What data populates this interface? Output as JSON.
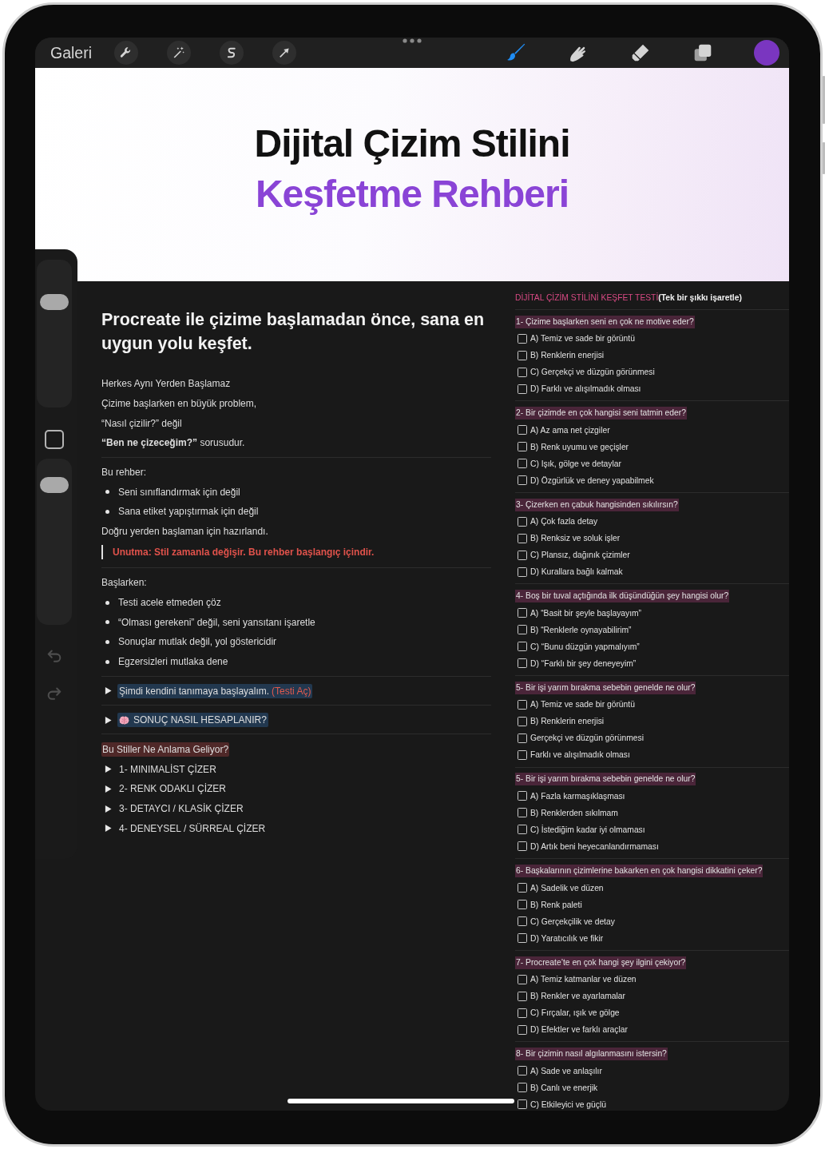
{
  "toolbar": {
    "gallery_label": "Galeri",
    "paint_tools": [
      {
        "selected": true
      },
      {
        "selected": false
      },
      {
        "selected": false
      },
      {
        "selected": false
      }
    ],
    "color_swatch": {
      "color": "#7a36c0"
    }
  },
  "side_panel": {
    "brush_size": {
      "level": 0.74
    },
    "opacity": {
      "level": 0.88
    }
  },
  "banner": {
    "title_line_1": "Dijital Çizim Stilini",
    "title_line_2": "Keşfetme Rehberi"
  },
  "guide": {
    "heading": "Procreate ile çizime başlamadan önce, sana en uygun yolu keşfet.",
    "blocks": [
      {
        "kind": "text",
        "text": "Herkes Aynı Yerden Başlamaz"
      },
      {
        "kind": "text",
        "text": "Çizime başlarken en büyük problem,"
      },
      {
        "kind": "text",
        "text": "“Nasıl çizilir?” değil"
      },
      {
        "kind": "text",
        "text": "**“Ben ne çizeceğim?”** sorusudur."
      },
      {
        "kind": "divider"
      },
      {
        "kind": "text",
        "text": "Bu rehber:"
      },
      {
        "kind": "bullet",
        "text": "Seni sınıflandırmak için değil"
      },
      {
        "kind": "bullet",
        "text": "Sana etiket yapıştırmak için değil"
      },
      {
        "kind": "text",
        "text": "Doğru yerden başlaman için hazırlandı."
      },
      {
        "kind": "quote",
        "text": "Unutma: Stil zamanla değişir. Bu rehber başlangıç içindir."
      },
      {
        "kind": "divider"
      },
      {
        "kind": "text",
        "text": "Başlarken:"
      },
      {
        "kind": "bullet",
        "text": "Testi acele etmeden çöz"
      },
      {
        "kind": "bullet",
        "text": "“Olması gerekeni” değil, seni yansıtanı işaretle"
      },
      {
        "kind": "bullet",
        "text": "Sonuçlar mutlak değil, yol göstericidir"
      },
      {
        "kind": "bullet",
        "text": "Egzersizleri mutlaka dene"
      },
      {
        "kind": "divider"
      },
      {
        "kind": "toggle",
        "text": "Şimdi kendini tanımaya başlayalım.",
        "link": "(Testi Aç)",
        "highlighted": true,
        "has_icon": false,
        "expanded": false
      },
      {
        "kind": "divider"
      },
      {
        "kind": "toggle",
        "text": "SONUÇ NASIL HESAPLANIR?",
        "highlighted": true,
        "has_icon": true,
        "expanded": false
      },
      {
        "kind": "divider"
      },
      {
        "kind": "tag_heading",
        "text": "Bu Stiller Ne Anlama Geliyor?"
      },
      {
        "kind": "toggle",
        "text": "1- MINIMALİST ÇİZER",
        "highlighted": false,
        "has_icon": false,
        "expanded": false
      },
      {
        "kind": "toggle",
        "text": "2- RENK ODAKLI ÇİZER",
        "highlighted": false,
        "has_icon": false,
        "expanded": false
      },
      {
        "kind": "toggle",
        "text": "3- DETAYCI / KLASİK ÇİZER",
        "highlighted": false,
        "has_icon": false,
        "expanded": false
      },
      {
        "kind": "toggle",
        "text": "4- DENEYSEL / SÜRREAL ÇİZER",
        "highlighted": false,
        "has_icon": false,
        "expanded": false
      }
    ]
  },
  "quiz": {
    "title": "DİJİTAL ÇİZİM STİLİNİ KEŞFET TESTİ",
    "hint": "(Tek bir şıkkı işaretle)",
    "questions": [
      {
        "title": "1- Çizime başlarken seni en çok ne motive eder?",
        "options": [
          {
            "text": "A) Temiz ve sade bir görüntü",
            "checked": false
          },
          {
            "text": "B) Renklerin enerjisi",
            "checked": false
          },
          {
            "text": "C) Gerçekçi ve düzgün görünmesi",
            "checked": false
          },
          {
            "text": "D) Farklı ve alışılmadık olması",
            "checked": false
          }
        ]
      },
      {
        "title": "2- Bir çizimde en çok hangisi seni tatmin eder?",
        "options": [
          {
            "text": "A) Az ama net çizgiler",
            "checked": false
          },
          {
            "text": "B) Renk uyumu ve geçişler",
            "checked": false
          },
          {
            "text": "C) Işık, gölge ve detaylar",
            "checked": false
          },
          {
            "text": "D) Özgürlük ve deney yapabilmek",
            "checked": false
          }
        ]
      },
      {
        "title": "3- Çizerken en çabuk hangisinden sıkılırsın?",
        "options": [
          {
            "text": "A) Çok fazla detay",
            "checked": false
          },
          {
            "text": "B) Renksiz ve soluk işler",
            "checked": false
          },
          {
            "text": "C) Plansız, dağınık çizimler",
            "checked": false
          },
          {
            "text": "D) Kurallara bağlı kalmak",
            "checked": false
          }
        ]
      },
      {
        "title": "4- Boş bir tuval açtığında ilk düşündüğün şey hangisi olur?",
        "options": [
          {
            "text": "A) “Basit bir şeyle başlayayım”",
            "checked": false
          },
          {
            "text": "B) “Renklerle oynayabilirim”",
            "checked": false
          },
          {
            "text": "C) “Bunu düzgün yapmalıyım”",
            "checked": false
          },
          {
            "text": "D) “Farklı bir şey deneyeyim”",
            "checked": false
          }
        ]
      },
      {
        "title": "5- Bir işi yarım bırakma sebebin genelde ne olur?",
        "options": [
          {
            "text": "A) Temiz ve sade bir görüntü",
            "checked": false
          },
          {
            "text": "B) Renklerin enerjisi",
            "checked": false
          },
          {
            "text": "Gerçekçi ve düzgün görünmesi",
            "checked": false
          },
          {
            "text": "Farklı ve alışılmadık olması",
            "checked": false
          }
        ]
      },
      {
        "title": "5- Bir işi yarım bırakma sebebin genelde ne olur?",
        "options": [
          {
            "text": "A) Fazla karmaşıklaşması",
            "checked": false
          },
          {
            "text": "B) Renklerden sıkılmam",
            "checked": false
          },
          {
            "text": "C) İstediğim kadar iyi olmaması",
            "checked": false
          },
          {
            "text": "D) Artık beni heyecanlandırmaması",
            "checked": false
          }
        ]
      },
      {
        "title": "6- Başkalarının çizimlerine bakarken en çok hangisi dikkatini çeker?",
        "options": [
          {
            "text": "A) Sadelik ve düzen",
            "checked": false
          },
          {
            "text": "B) Renk paleti",
            "checked": false
          },
          {
            "text": "C) Gerçekçilik ve detay",
            "checked": false
          },
          {
            "text": "D) Yaratıcılık ve fikir",
            "checked": false
          }
        ]
      },
      {
        "title": "7- Procreate’te en çok hangi şey ilgini çekiyor?",
        "options": [
          {
            "text": "A) Temiz katmanlar ve düzen",
            "checked": false
          },
          {
            "text": "B) Renkler ve ayarlamalar",
            "checked": false
          },
          {
            "text": "C) Fırçalar, ışık ve gölge",
            "checked": false
          },
          {
            "text": "D) Efektler ve farklı araçlar",
            "checked": false
          }
        ]
      },
      {
        "title": "8- Bir çizimin nasıl algılanmasını istersin?",
        "options": [
          {
            "text": "A) Sade ve anlaşılır",
            "checked": false
          },
          {
            "text": "B) Canlı ve enerjik",
            "checked": false
          },
          {
            "text": "C) Etkileyici ve güçlü",
            "checked": false
          }
        ]
      }
    ]
  }
}
